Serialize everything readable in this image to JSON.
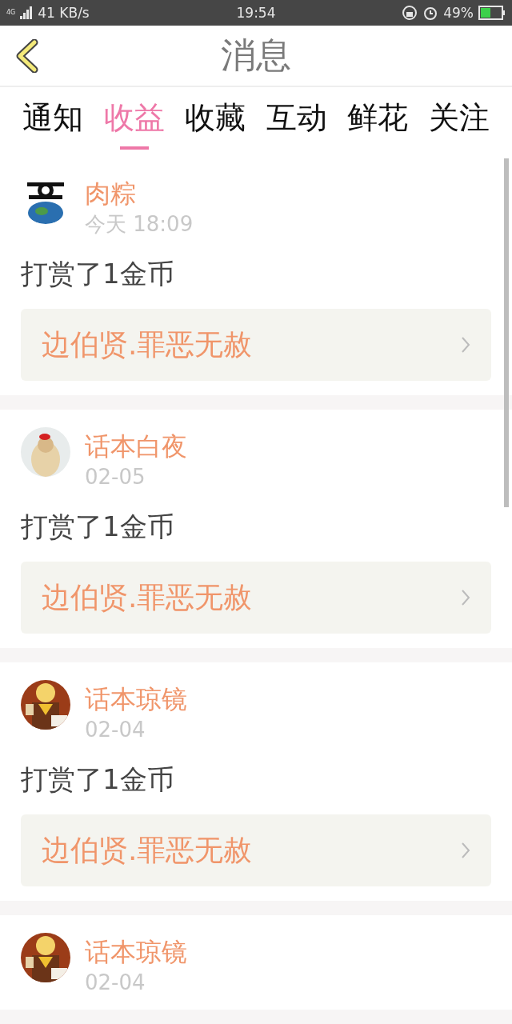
{
  "status_bar": {
    "network": "4G",
    "speed": "41 KB/s",
    "time": "19:54",
    "battery": "49%"
  },
  "header": {
    "title": "消息"
  },
  "tabs": [
    {
      "label": "通知",
      "selected": false
    },
    {
      "label": "收益",
      "selected": true
    },
    {
      "label": "收藏",
      "selected": false
    },
    {
      "label": "互动",
      "selected": false
    },
    {
      "label": "鲜花",
      "selected": false
    },
    {
      "label": "关注",
      "selected": false
    }
  ],
  "messages": [
    {
      "user": "肉粽",
      "time": "今天 18:09",
      "text": "打赏了1金币",
      "link": "边伯贤.罪恶无赦"
    },
    {
      "user": "话本白夜",
      "time": "02-05",
      "text": "打赏了1金币",
      "link": "边伯贤.罪恶无赦"
    },
    {
      "user": "话本琼镜",
      "time": "02-04",
      "text": "打赏了1金币",
      "link": "边伯贤.罪恶无赦"
    },
    {
      "user": "话本琼镜",
      "time": "02-04"
    }
  ]
}
